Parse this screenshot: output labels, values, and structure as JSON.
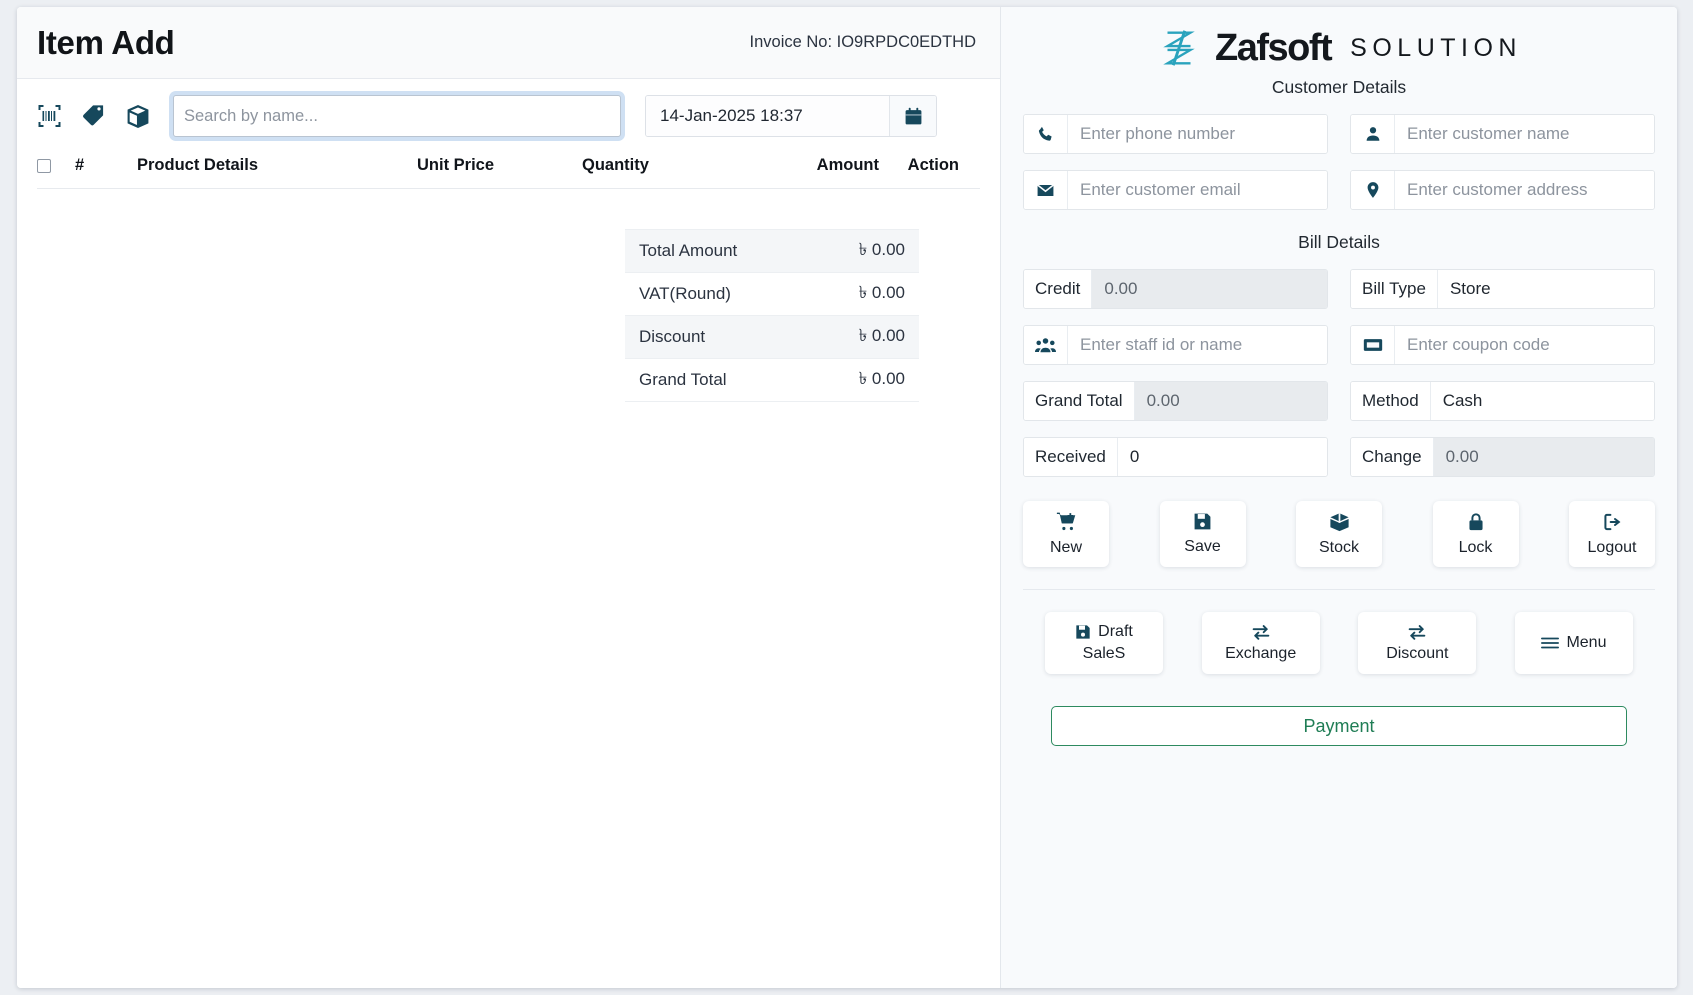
{
  "left": {
    "page_title": "Item Add",
    "invoice_label": "Invoice No: IO9RPDC0EDTHD",
    "toolbar": {
      "barcode_icon": "barcode-scan-icon",
      "tag_icon": "price-tag-icon",
      "box_icon": "package-box-icon",
      "search_placeholder": "Search by name...",
      "search_value": "",
      "date_value": "14-Jan-2025 18:37",
      "calendar_icon": "calendar-icon"
    },
    "table": {
      "headers": {
        "hash": "#",
        "product": "Product Details",
        "unit_price": "Unit Price",
        "quantity": "Quantity",
        "amount": "Amount",
        "action": "Action"
      },
      "rows": []
    },
    "totals": [
      {
        "label": "Total Amount",
        "value": "৳ 0.00"
      },
      {
        "label": "VAT(Round)",
        "value": "৳ 0.00"
      },
      {
        "label": "Discount",
        "value": "৳ 0.00"
      },
      {
        "label": "Grand Total",
        "value": "৳ 0.00"
      }
    ]
  },
  "right": {
    "brand": {
      "name": "Zafsoft",
      "suffix": "SOLUTION",
      "mark_color": "#2aa3bd"
    },
    "customer_title": "Customer Details",
    "customer_fields": [
      {
        "icon": "phone-icon",
        "placeholder": "Enter phone number",
        "value": ""
      },
      {
        "icon": "person-icon",
        "placeholder": "Enter customer name",
        "value": ""
      },
      {
        "icon": "envelope-icon",
        "placeholder": "Enter customer email",
        "value": ""
      },
      {
        "icon": "location-pin-icon",
        "placeholder": "Enter customer address",
        "value": ""
      }
    ],
    "bill_title": "Bill Details",
    "bill_fields": [
      {
        "label": "Credit",
        "value": "0.00",
        "disabled": true
      },
      {
        "label": "Bill Type",
        "value": "Store",
        "disabled": false
      },
      {
        "icon": "staff-group-icon",
        "placeholder": "Enter staff id or name",
        "value": ""
      },
      {
        "icon": "coupon-ticket-icon",
        "placeholder": "Enter coupon code",
        "value": ""
      },
      {
        "label": "Grand Total",
        "value": "0.00",
        "disabled": true
      },
      {
        "label": "Method",
        "value": "Cash",
        "disabled": false
      },
      {
        "label": "Received",
        "value": "0",
        "disabled": false
      },
      {
        "label": "Change",
        "value": "0.00",
        "disabled": true
      }
    ],
    "action_buttons": [
      {
        "label": "New",
        "icon": "cart-plus-icon"
      },
      {
        "label": "Save",
        "icon": "floppy-save-icon"
      },
      {
        "label": "Stock",
        "icon": "box-open-icon"
      },
      {
        "label": "Lock",
        "icon": "padlock-icon"
      },
      {
        "label": "Logout",
        "icon": "logout-arrow-icon"
      }
    ],
    "secondary_buttons": [
      {
        "label_top": "Draft",
        "label_bottom": "SaleS",
        "icon": "floppy-save-icon"
      },
      {
        "label_top": "",
        "label_bottom": "Exchange",
        "icon": "exchange-arrows-icon"
      },
      {
        "label_top": "",
        "label_bottom": "Discount",
        "icon": "exchange-arrows-icon"
      },
      {
        "label_top": "Menu",
        "label_bottom": "",
        "icon": "hamburger-menu-icon"
      }
    ],
    "payment_label": "Payment",
    "accent_color": "#1f7d55",
    "icon_color": "#16485c"
  }
}
